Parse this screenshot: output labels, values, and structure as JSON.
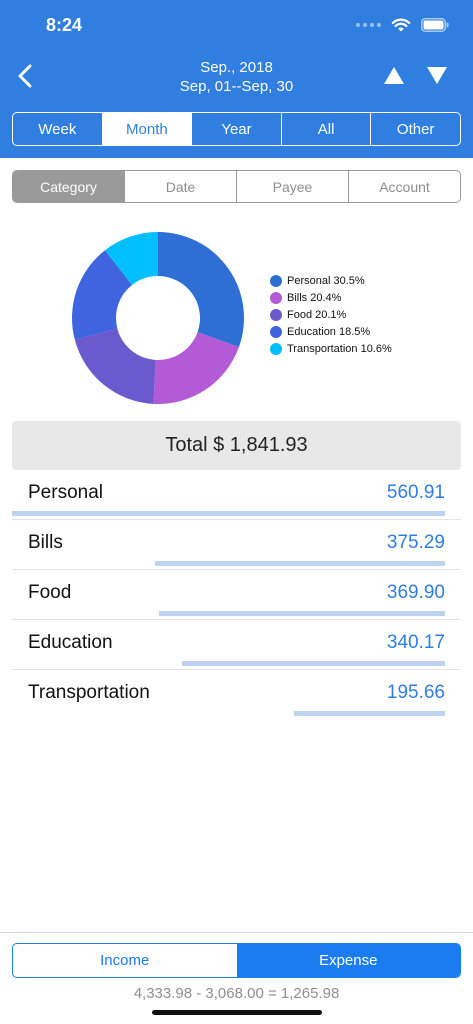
{
  "status": {
    "time": "8:24"
  },
  "header": {
    "period_month": "Sep., 2018",
    "period_range": "Sep, 01--Sep, 30"
  },
  "range_tabs": [
    {
      "label": "Week",
      "active": false
    },
    {
      "label": "Month",
      "active": true
    },
    {
      "label": "Year",
      "active": false
    },
    {
      "label": "All",
      "active": false
    },
    {
      "label": "Other",
      "active": false
    }
  ],
  "group_tabs": [
    {
      "label": "Category",
      "active": true
    },
    {
      "label": "Date",
      "active": false
    },
    {
      "label": "Payee",
      "active": false
    },
    {
      "label": "Account",
      "active": false
    }
  ],
  "chart_data": {
    "type": "pie",
    "categories": [
      "Personal",
      "Bills",
      "Food",
      "Education",
      "Transportation"
    ],
    "values": [
      30.5,
      20.4,
      20.1,
      18.5,
      10.6
    ],
    "legend": [
      "Personal 30.5%",
      "Bills 20.4%",
      "Food 20.1%",
      "Education 18.5%",
      "Transportation 10.6%"
    ],
    "colors": [
      "#2e6fd6",
      "#b35ad6",
      "#6a5acd",
      "#3f64df",
      "#00bfff"
    ],
    "legend_position": "right"
  },
  "total_label": "Total $ 1,841.93",
  "items": [
    {
      "name": "Personal",
      "amount": "560.91",
      "value": 560.91
    },
    {
      "name": "Bills",
      "amount": "375.29",
      "value": 375.29
    },
    {
      "name": "Food",
      "amount": "369.90",
      "value": 369.9
    },
    {
      "name": "Education",
      "amount": "340.17",
      "value": 340.17
    },
    {
      "name": "Transportation",
      "amount": "195.66",
      "value": 195.66
    }
  ],
  "bottom": {
    "income_label": "Income",
    "expense_label": "Expense",
    "active": "expense",
    "formula": "4,333.98 - 3,068.00 = 1,265.98"
  },
  "colors": {
    "header": "#2f7ee0",
    "accent": "#1a7cf0",
    "bar": "#bdd3f0"
  }
}
